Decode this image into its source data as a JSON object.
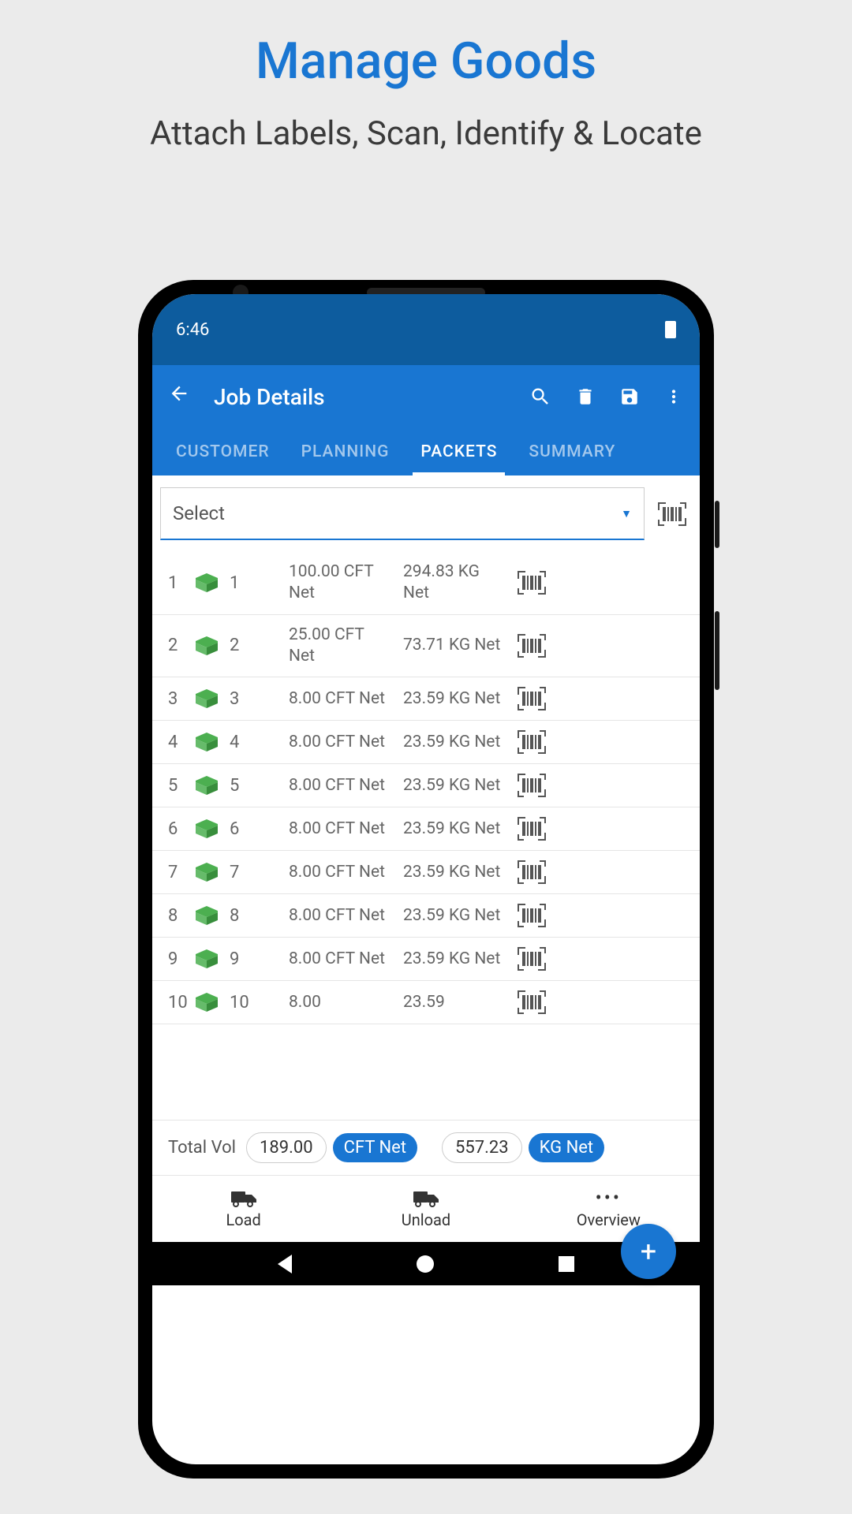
{
  "page": {
    "title": "Manage Goods",
    "subtitle": "Attach Labels, Scan, Identify & Locate"
  },
  "status": {
    "time": "6:46"
  },
  "appBar": {
    "title": "Job Details"
  },
  "tabs": {
    "customer": "CUSTOMER",
    "planning": "PLANNING",
    "packets": "PACKETS",
    "summary": "SUMMARY"
  },
  "select": {
    "placeholder": "Select"
  },
  "packets": [
    {
      "num": "1",
      "id": "1",
      "vol": "100.00 CFT Net",
      "wt": "294.83 KG Net"
    },
    {
      "num": "2",
      "id": "2",
      "vol": "25.00 CFT Net",
      "wt": "73.71 KG Net"
    },
    {
      "num": "3",
      "id": "3",
      "vol": "8.00 CFT Net",
      "wt": "23.59 KG Net"
    },
    {
      "num": "4",
      "id": "4",
      "vol": "8.00 CFT Net",
      "wt": "23.59 KG Net"
    },
    {
      "num": "5",
      "id": "5",
      "vol": "8.00 CFT Net",
      "wt": "23.59 KG Net"
    },
    {
      "num": "6",
      "id": "6",
      "vol": "8.00 CFT Net",
      "wt": "23.59 KG Net"
    },
    {
      "num": "7",
      "id": "7",
      "vol": "8.00 CFT Net",
      "wt": "23.59 KG Net"
    },
    {
      "num": "8",
      "id": "8",
      "vol": "8.00 CFT Net",
      "wt": "23.59 KG Net"
    },
    {
      "num": "9",
      "id": "9",
      "vol": "8.00 CFT Net",
      "wt": "23.59 KG Net"
    },
    {
      "num": "10",
      "id": "10",
      "vol": "8.00",
      "wt": "23.59"
    }
  ],
  "totals": {
    "label": "Total Vol",
    "volValue": "189.00",
    "volUnit": "CFT Net",
    "wtValue": "557.23",
    "wtUnit": "KG Net"
  },
  "nav": {
    "load": "Load",
    "unload": "Unload",
    "overview": "Overview"
  }
}
